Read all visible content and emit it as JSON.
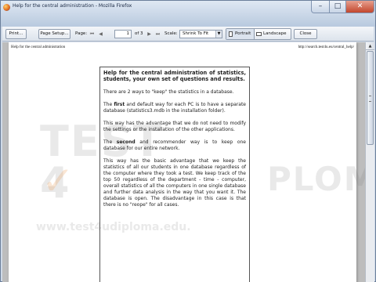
{
  "window": {
    "title": "Help for the central administration - Mozilla Firefox",
    "min_glyph": "–",
    "max_glyph": "□",
    "close_glyph": "✕"
  },
  "toolbar": {
    "print_label": "Print...",
    "page_setup_label": "Page Setup...",
    "page_label": "Page:",
    "first_glyph": "⏮",
    "prev_glyph": "◀",
    "next_glyph": "▶",
    "last_glyph": "⏭",
    "page_value": "1",
    "of_label": "of",
    "page_total": "3",
    "scale_label": "Scale:",
    "scale_value": "Shrink To Fit",
    "portrait_label": "Portrait",
    "landscape_label": "Landscape",
    "close_label": "Close"
  },
  "preview": {
    "header_left": "Help for the central administration",
    "header_right": "http://search.test4u.eu/central_help/",
    "watermark_test": "TEST",
    "watermark_4": "4",
    "watermark_diploma": "PLOMA",
    "watermark_url": "www.test4udiploma.edu.",
    "title": "Help for the central administration of statistics, students, your own set of questions and results.",
    "p1": "There are 2 ways to \"keep\" the statistics in a database.",
    "p2_strong": "first",
    "p2_pre": "The ",
    "p2_post": " and default way for each PC is to have a separate database (statistics3.mdb in the installation folder).",
    "p3": "This way has the advantage that we do not need to modify the settings or the installation of the other applications.",
    "p4_pre": "The ",
    "p4_strong": "second",
    "p4_post": " and recommender way is to keep one database for our entire network.",
    "p5": "This way has the basic advantage that we keep the statistics of all our students in one database regardless of the computer where they took a test. We keep track of the top 50 regardless of the department - time - computer, overall statistics of all the computers in one single database and further data analysis in the way that you want it. The database is open. The disadvantage in this case is that there is no \"reope\" for all cases."
  }
}
